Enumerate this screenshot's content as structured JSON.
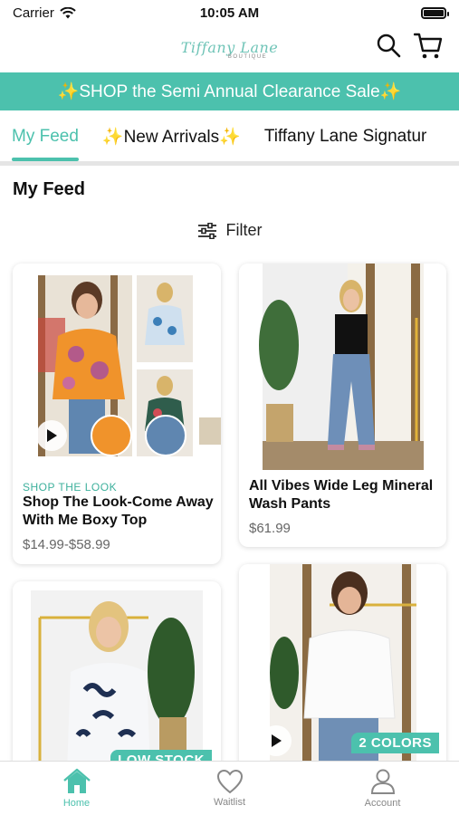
{
  "status_bar": {
    "carrier": "Carrier",
    "time": "10:05 AM"
  },
  "header": {
    "logo_script": "Tiffany Lane",
    "logo_sub": "BOUTIQUE"
  },
  "banner": {
    "text": "✨SHOP the Semi Annual Clearance Sale✨"
  },
  "tabs": [
    {
      "label": "My Feed",
      "active": true
    },
    {
      "label": "✨New Arrivals✨",
      "active": false
    },
    {
      "label": "Tiffany Lane Signatur",
      "active": false
    }
  ],
  "feed": {
    "title": "My Feed",
    "filter_label": "Filter"
  },
  "products": [
    {
      "kicker": "SHOP THE LOOK",
      "title": "Shop The Look-Come Away With Me Boxy Top",
      "price": "$14.99-$58.99"
    },
    {
      "title": "All Vibes Wide Leg Mineral Wash Pants",
      "price": "$61.99"
    },
    {
      "badge": "LOW STOCK"
    },
    {
      "badge": "2 COLORS"
    }
  ],
  "bottom_nav": [
    {
      "label": "Home",
      "icon": "home-icon",
      "active": true
    },
    {
      "label": "Waitlist",
      "icon": "heart-icon",
      "active": false
    },
    {
      "label": "Account",
      "icon": "person-icon",
      "active": false
    }
  ],
  "colors": {
    "accent": "#4cc1ad",
    "text": "#111111",
    "muted": "#666666"
  }
}
